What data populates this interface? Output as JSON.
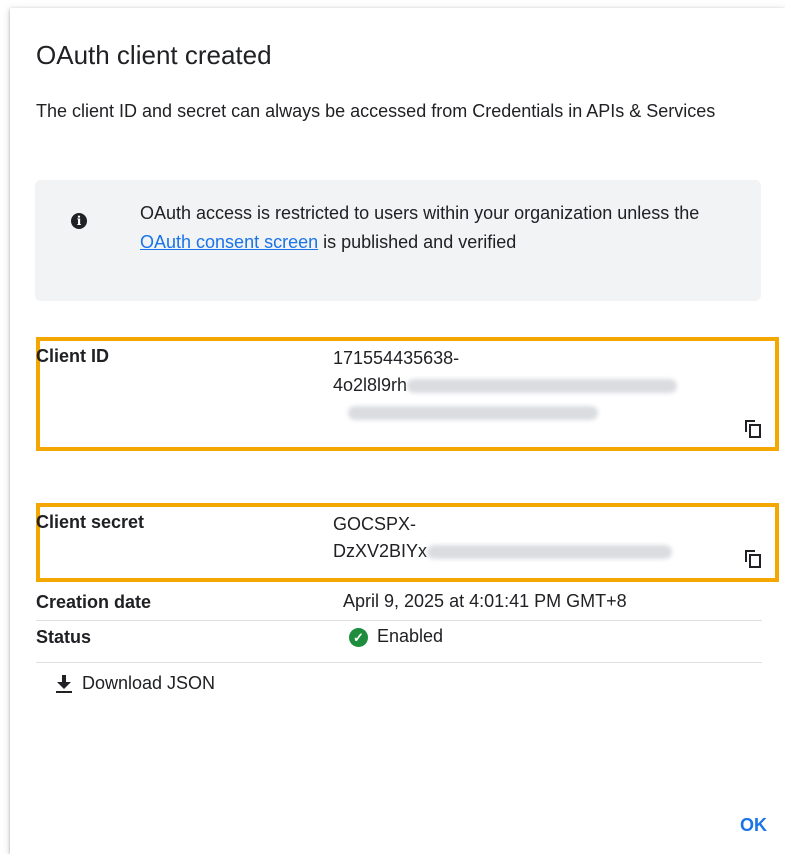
{
  "dialog": {
    "title": "OAuth client created",
    "description": "The client ID and secret can always be accessed from Credentials in APIs & Services"
  },
  "notice": {
    "text_before": "OAuth access is restricted to users within your organization unless the ",
    "link": "OAuth consent screen",
    "text_after": " is published and verified",
    "icon": "info-icon"
  },
  "fields": {
    "client_id": {
      "label": "Client ID",
      "value_line1": "171554435638-",
      "value_line2": "4o2l8l9rh"
    },
    "client_secret": {
      "label": "Client secret",
      "value_line1": "GOCSPX-",
      "value_line2": "DzXV2BIYx"
    },
    "creation_date": {
      "label": "Creation date",
      "value": "April 9, 2025 at 4:01:41 PM GMT+8"
    },
    "status": {
      "label": "Status",
      "value": "Enabled",
      "icon": "check-circle-icon"
    }
  },
  "actions": {
    "download": "Download JSON",
    "ok": "OK"
  },
  "colors": {
    "highlight": "#f4a700",
    "link": "#1a73e8",
    "enabled": "#1e8e3e"
  }
}
